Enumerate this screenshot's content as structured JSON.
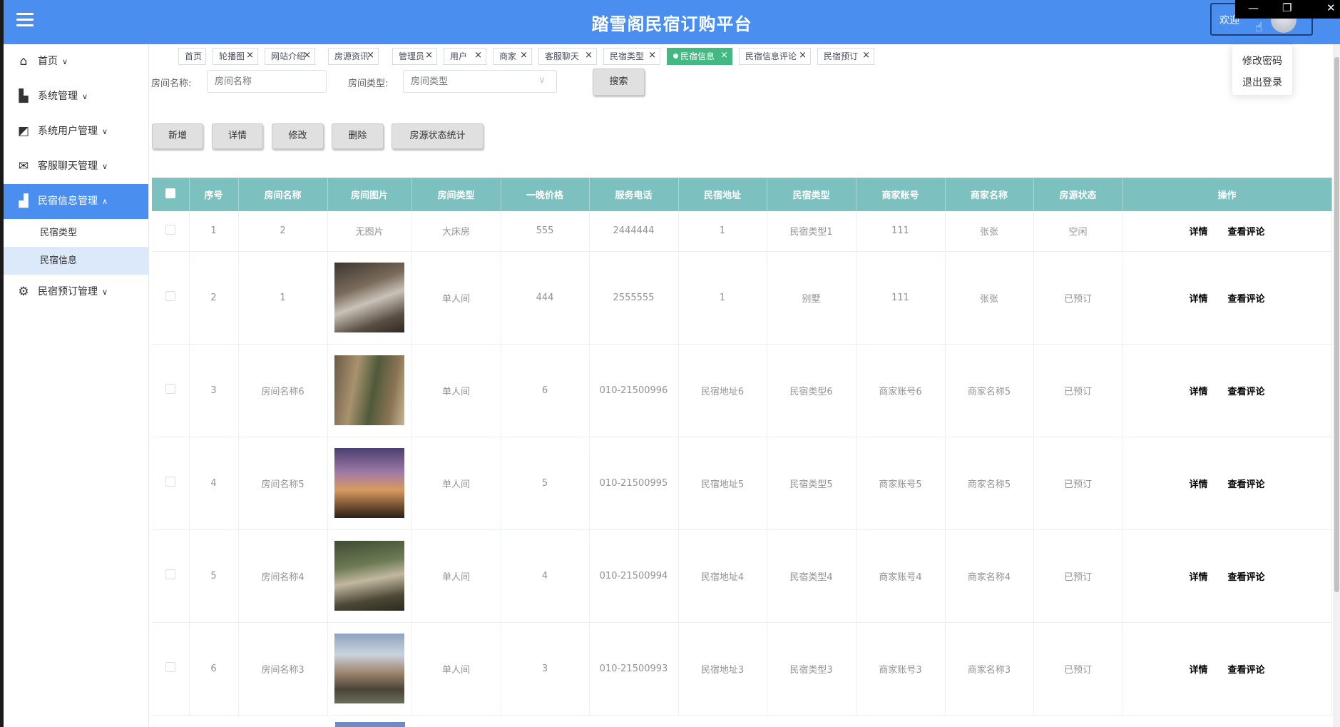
{
  "header": {
    "title": "踏雪阁民宿订购平台",
    "welcome": "欢迎",
    "dropdown": [
      "修改密码",
      "退出登录"
    ]
  },
  "window_controls": {
    "minimize": "—",
    "restore": "❐",
    "close": "✕"
  },
  "sidebar": {
    "items": [
      {
        "label": "首页",
        "icon": "home-icon",
        "arrow": "∨"
      },
      {
        "label": "系统管理",
        "icon": "chart-icon",
        "arrow": "∨"
      },
      {
        "label": "系统用户管理",
        "icon": "user-card-icon",
        "arrow": "∨"
      },
      {
        "label": "客服聊天管理",
        "icon": "mail-icon",
        "arrow": "∨"
      },
      {
        "label": "民宿信息管理",
        "icon": "building-icon",
        "arrow": "∧",
        "active": true
      },
      {
        "label": "民宿预订管理",
        "icon": "chip-icon",
        "arrow": "∨"
      }
    ],
    "subitems": [
      {
        "label": "民宿类型"
      },
      {
        "label": "民宿信息",
        "active": true
      }
    ]
  },
  "tabs": [
    {
      "label": "首页",
      "closable": false
    },
    {
      "label": "轮播图",
      "closable": true
    },
    {
      "label": "网站介绍",
      "closable": true
    },
    {
      "label": "房源资讯",
      "closable": true
    },
    {
      "label": "管理员",
      "closable": true
    },
    {
      "label": "用户",
      "closable": true
    },
    {
      "label": "商家",
      "closable": true
    },
    {
      "label": "客服聊天",
      "closable": true
    },
    {
      "label": "民宿类型",
      "closable": true
    },
    {
      "label": "民宿信息",
      "closable": true,
      "active": true
    },
    {
      "label": "民宿信息评论",
      "closable": true
    },
    {
      "label": "民宿预订",
      "closable": true
    }
  ],
  "search": {
    "room_name_label": "房间名称:",
    "room_name_placeholder": "房间名称",
    "room_type_label": "房间类型:",
    "room_type_placeholder": "房间类型",
    "search_button": "搜索"
  },
  "toolbar": {
    "add": "新增",
    "detail": "详情",
    "edit": "修改",
    "delete": "删除",
    "stats": "房源状态统计"
  },
  "table": {
    "columns": [
      "序号",
      "房间名称",
      "房间图片",
      "房间类型",
      "一晚价格",
      "服务电话",
      "民宿地址",
      "民宿类型",
      "商家账号",
      "商家名称",
      "房源状态",
      "操作"
    ],
    "no_image_text": "无图片",
    "op_detail": "详情",
    "op_comments": "查看评论",
    "rows": [
      {
        "no": "1",
        "name": "2",
        "image": "",
        "type": "大床房",
        "price": "555",
        "phone": "2444444",
        "address": "1",
        "bnb_type": "民宿类型1",
        "merchant_account": "111",
        "merchant_name": "张张",
        "status": "空闲"
      },
      {
        "no": "2",
        "name": "1",
        "image": "hotel-bedroom",
        "type": "单人间",
        "price": "444",
        "phone": "2555555",
        "address": "1",
        "bnb_type": "别墅",
        "merchant_account": "111",
        "merchant_name": "张张",
        "status": "已预订"
      },
      {
        "no": "3",
        "name": "房间名称6",
        "image": "courtyard-house",
        "type": "单人间",
        "price": "6",
        "phone": "010-21500996",
        "address": "民宿地址6",
        "bnb_type": "民宿类型6",
        "merchant_account": "商家账号6",
        "merchant_name": "商家名称5",
        "status": "已预订"
      },
      {
        "no": "4",
        "name": "房间名称5",
        "image": "villa-dusk",
        "type": "单人间",
        "price": "5",
        "phone": "010-21500995",
        "address": "民宿地址5",
        "bnb_type": "民宿类型5",
        "merchant_account": "商家账号5",
        "merchant_name": "商家名称5",
        "status": "已预订"
      },
      {
        "no": "5",
        "name": "房间名称4",
        "image": "garden-house",
        "type": "单人间",
        "price": "4",
        "phone": "010-21500994",
        "address": "民宿地址4",
        "bnb_type": "民宿类型4",
        "merchant_account": "商家账号4",
        "merchant_name": "商家名称4",
        "status": "已预订"
      },
      {
        "no": "6",
        "name": "房间名称3",
        "image": "winter-courtyard",
        "type": "单人间",
        "price": "3",
        "phone": "010-21500993",
        "address": "民宿地址3",
        "bnb_type": "民宿类型3",
        "merchant_account": "商家账号3",
        "merchant_name": "商家名称3",
        "status": "已预订"
      }
    ]
  }
}
